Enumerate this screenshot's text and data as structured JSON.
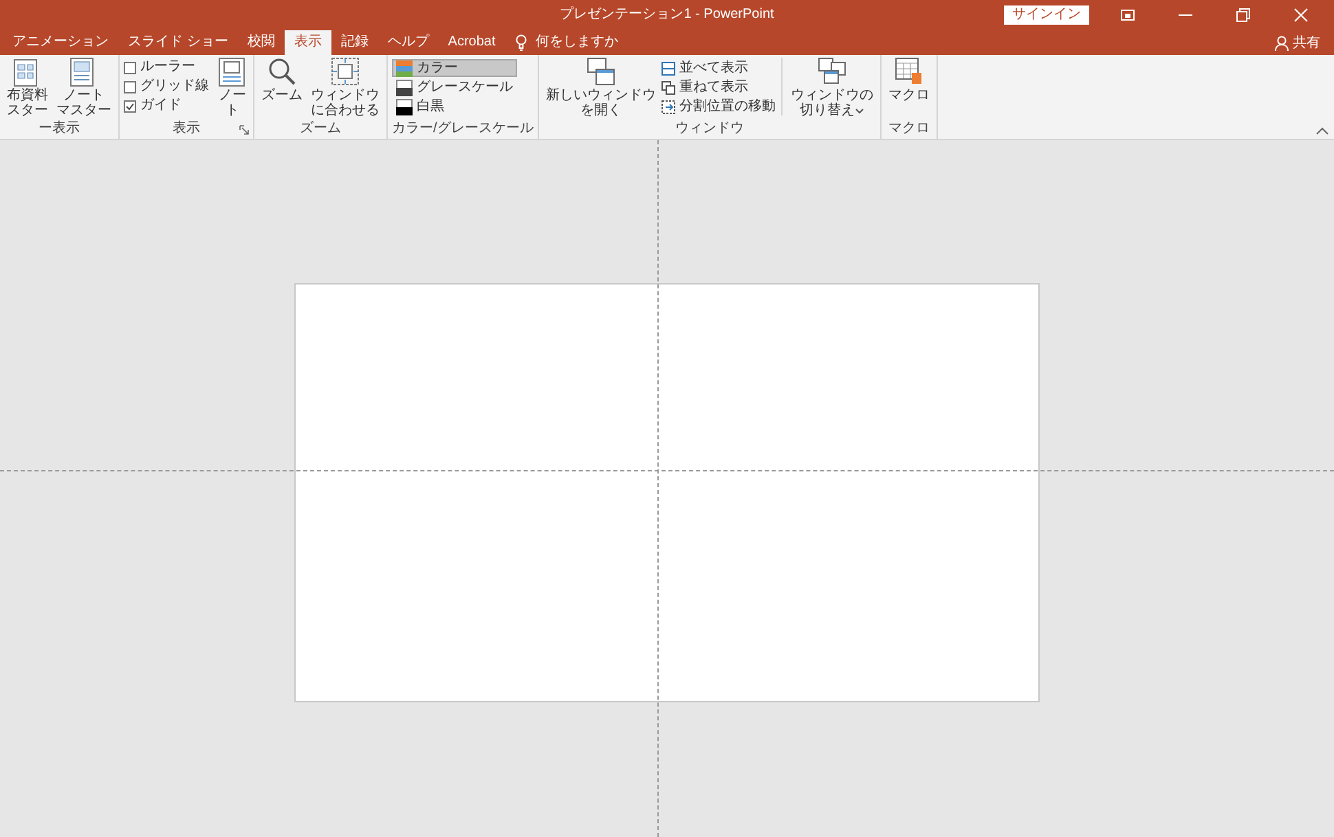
{
  "window": {
    "title": "プレゼンテーション1 - PowerPoint",
    "sign_in": "サインイン",
    "share": "共有"
  },
  "tabs": [
    {
      "label": "アニメーション",
      "selected": false
    },
    {
      "label": "スライド ショー",
      "selected": false
    },
    {
      "label": "校閲",
      "selected": false
    },
    {
      "label": "表示",
      "selected": true
    },
    {
      "label": "記録",
      "selected": false
    },
    {
      "label": "ヘルプ",
      "selected": false
    },
    {
      "label": "Acrobat",
      "selected": false
    }
  ],
  "tell_me": "何をしますか",
  "ribbon": {
    "groups": [
      {
        "label": "ー表示",
        "items": [
          {
            "kind": "large",
            "lines": [
              "布資料",
              "スター"
            ]
          },
          {
            "kind": "large",
            "lines": [
              "ノート",
              "マスター"
            ]
          }
        ]
      },
      {
        "label": "表示",
        "launcher": true,
        "items": [
          {
            "kind": "checks",
            "checks": [
              {
                "label": "ルーラー",
                "checked": false
              },
              {
                "label": "グリッド線",
                "checked": false
              },
              {
                "label": "ガイド",
                "checked": true
              }
            ]
          },
          {
            "kind": "large",
            "lines": [
              "ノー",
              "ト"
            ]
          }
        ]
      },
      {
        "label": "ズーム",
        "items": [
          {
            "kind": "large",
            "lines": [
              "ズーム"
            ]
          },
          {
            "kind": "large",
            "lines": [
              "ウィンドウ",
              "に合わせる"
            ]
          }
        ]
      },
      {
        "label": "カラー/グレースケール",
        "items": [
          {
            "kind": "options",
            "options": [
              {
                "label": "カラー",
                "selected": true
              },
              {
                "label": "グレースケール",
                "selected": false
              },
              {
                "label": "白黒",
                "selected": false
              }
            ]
          }
        ]
      },
      {
        "label": "ウィンドウ",
        "items": [
          {
            "kind": "large",
            "lines": [
              "新しいウィンドウ",
              "を開く"
            ]
          },
          {
            "kind": "small",
            "buttons": [
              "並べて表示",
              "重ねて表示",
              "分割位置の移動"
            ]
          },
          {
            "kind": "divider"
          },
          {
            "kind": "large",
            "lines": [
              "ウィンドウの",
              "切り替え"
            ],
            "dropdown": true
          }
        ]
      },
      {
        "label": "マクロ",
        "items": [
          {
            "kind": "large",
            "lines": [
              "マクロ"
            ]
          }
        ]
      }
    ]
  }
}
